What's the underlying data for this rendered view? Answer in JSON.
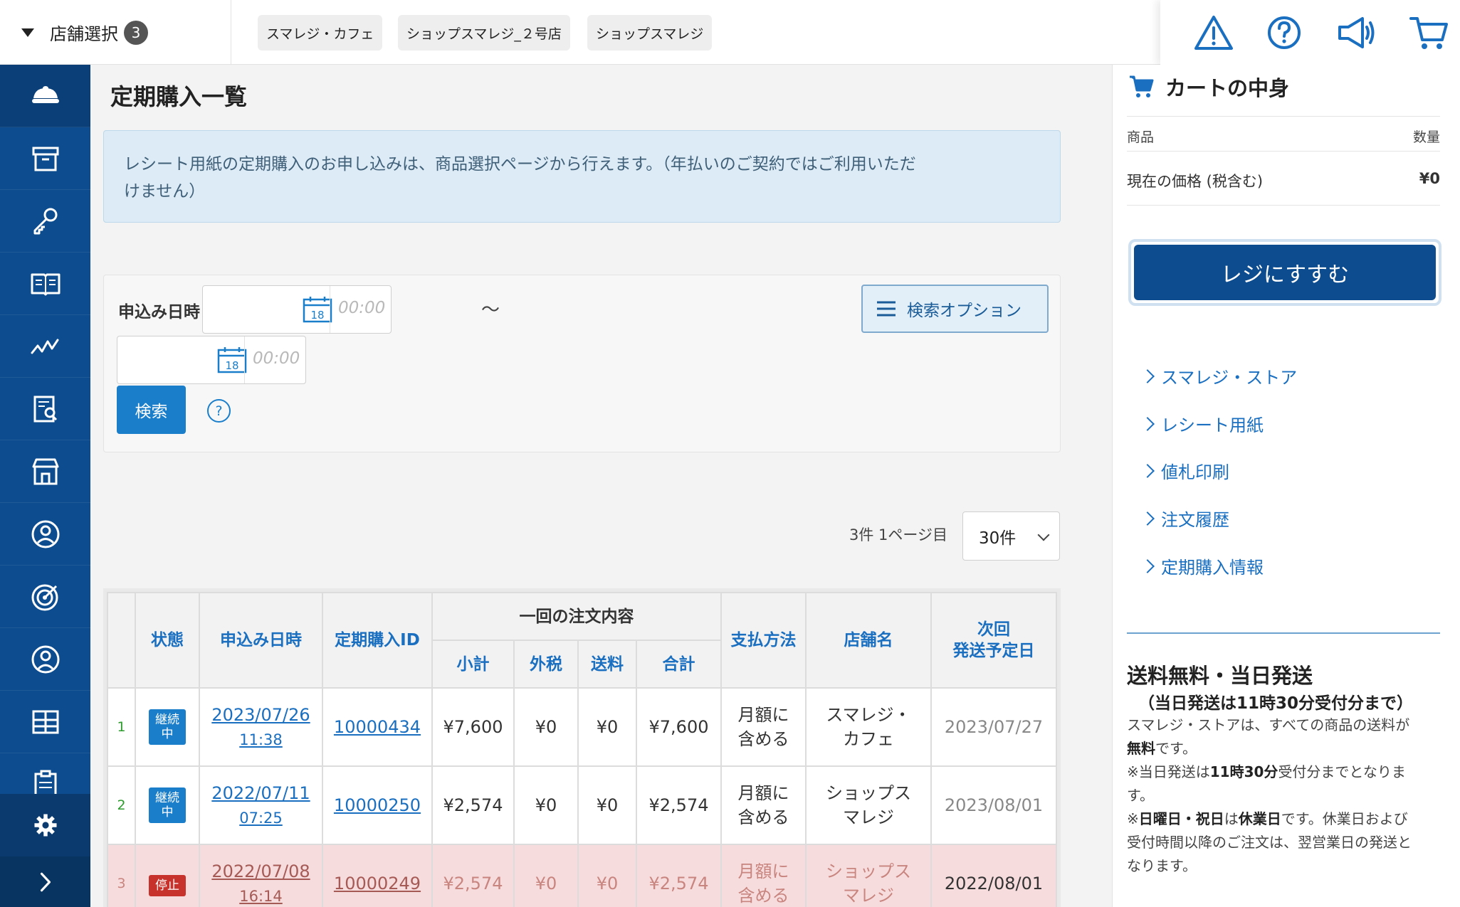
{
  "topbar": {
    "store_select_label": "店舗選択",
    "store_count": "3",
    "shops": [
      "スマレジ・カフェ",
      "ショップスマレジ_２号店",
      "ショップスマレジ"
    ]
  },
  "sidebar": {
    "items": [
      "home-icon",
      "box-icon",
      "key-icon",
      "book-icon",
      "chart-icon",
      "report-search-icon",
      "store-icon",
      "user-circle-icon",
      "target-icon",
      "person-icon",
      "apps-icon",
      "clipboard-icon"
    ],
    "settings_icon": "gear-icon",
    "expand_icon": "chevron-right-icon"
  },
  "main": {
    "title": "定期購入一覧",
    "info_line1": "レシート用紙の定期購入のお申し込みは、商品選択ページから行えます。（年払いのご契約ではご利用いただ",
    "info_line2": "けません）",
    "search": {
      "date_label": "申込み日時 ：",
      "time_placeholder": "00:00",
      "calendar_day": "18",
      "tilde": "〜",
      "options_label": "検索オプション",
      "search_button": "検索",
      "help": "?"
    },
    "count_text": "3件 1ページ目",
    "per_page": "30件"
  },
  "table": {
    "headers": {
      "status": "状態",
      "applied_at": "申込み日時",
      "sub_id": "定期購入ID",
      "order_group": "一回の注文内容",
      "subtotal": "小計",
      "tax": "外税",
      "shipping": "送料",
      "total": "合計",
      "payment": "支払方法",
      "store": "店舗名",
      "next_ship_line1": "次回",
      "next_ship_line2": "発送予定日"
    },
    "rows": [
      {
        "idx": "1",
        "status_l1": "継続",
        "status_l2": "中",
        "date": "2023/07/26",
        "time": "11:38",
        "id": "10000434",
        "subtotal": "¥7,600",
        "tax": "¥0",
        "shipping": "¥0",
        "total": "¥7,600",
        "pay_l1": "月額に",
        "pay_l2": "含める",
        "store_l1": "スマレジ・",
        "store_l2": "カフェ",
        "next": "2023/07/27"
      },
      {
        "idx": "2",
        "status_l1": "継続",
        "status_l2": "中",
        "date": "2022/07/11",
        "time": "07:25",
        "id": "10000250",
        "subtotal": "¥2,574",
        "tax": "¥0",
        "shipping": "¥0",
        "total": "¥2,574",
        "pay_l1": "月額に",
        "pay_l2": "含める",
        "store_l1": "ショップス",
        "store_l2": "マレジ",
        "next": "2023/08/01"
      },
      {
        "idx": "3",
        "status_l1": "停止",
        "status_l2": "",
        "date": "2022/07/08",
        "time": "16:14",
        "id": "10000249",
        "subtotal": "¥2,574",
        "tax": "¥0",
        "shipping": "¥0",
        "total": "¥2,574",
        "pay_l1": "月額に",
        "pay_l2": "含める",
        "store_l1": "ショップス",
        "store_l2": "マレジ",
        "next": "2022/08/01"
      }
    ]
  },
  "cart": {
    "title": "カートの中身",
    "col_product": "商品",
    "col_qty": "数量",
    "price_label": "現在の価格 (税含む)",
    "price_value": "¥0",
    "checkout": "レジにすすむ",
    "links": [
      "スマレジ・ストア",
      "レシート用紙",
      "値札印刷",
      "注文履歴",
      "定期購入情報"
    ]
  },
  "shipping_info": {
    "title": "送料無料・当日発送",
    "subtitle": "（当日発送は11時30分受付分まで）",
    "p1a": "スマレジ・ストアは、すべての商品の送料が",
    "p1b": "無料",
    "p1c": "です。",
    "p2a": "※当日発送は",
    "p2b": "11時30分",
    "p2c": "受付分までとなりま",
    "p2d": "す。",
    "p3a": "※",
    "p3b": "日曜日・祝日",
    "p3c": "は",
    "p3d": "休業日",
    "p3e": "です。休業日および",
    "p3f": "受付時間以降のご注文は、翌営業日の発送と",
    "p3g": "なります。"
  },
  "colors": {
    "sidebar": "#0d4c8e",
    "accent": "#1a7ecb",
    "link": "#1a6fc0",
    "stopped_row": "#f7dcdd",
    "status_stop": "#c8322c"
  }
}
